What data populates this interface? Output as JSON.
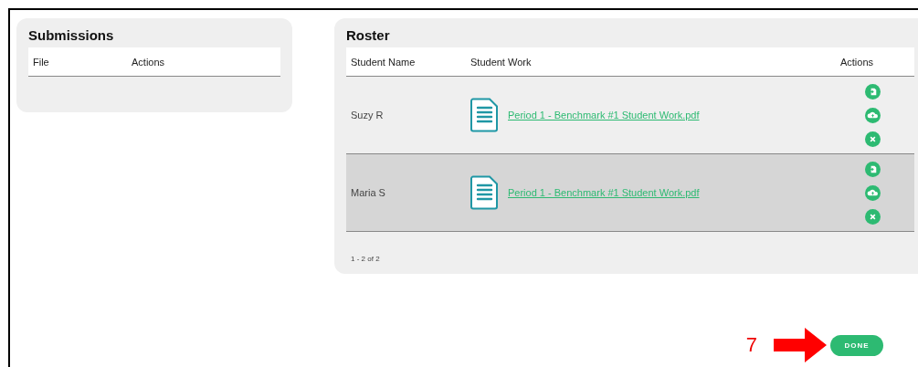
{
  "submissions": {
    "title": "Submissions",
    "columns": [
      "File",
      "Actions"
    ]
  },
  "roster": {
    "title": "Roster",
    "columns": [
      "Student Name",
      "Student Work",
      "Actions"
    ],
    "rows": [
      {
        "student_name": "Suzy R",
        "file": "Period 1 - Benchmark #1 Student Work.pdf",
        "selected": false
      },
      {
        "student_name": "Maria S",
        "file": "Period 1 - Benchmark #1 Student Work.pdf",
        "selected": true
      }
    ],
    "pagination": "1 - 2 of 2"
  },
  "annotation": {
    "step": "7"
  },
  "done_button": "DONE"
}
